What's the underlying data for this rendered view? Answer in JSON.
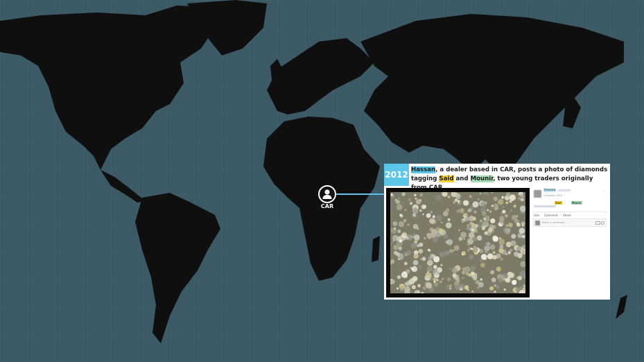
{
  "map": {
    "ocean_color": "#3c5966",
    "land_color": "#0f0f0f",
    "grid": true
  },
  "marker": {
    "label": "CAR",
    "icon": "person-icon",
    "accent": "#5bc6e8"
  },
  "event": {
    "year": "2012",
    "caption": {
      "name1": "Hassan",
      "text1": ", a dealer based in CAR, posts a photo of diamonds tagging ",
      "name2": "Said",
      "text2": " and ",
      "name3": "Mounir",
      "text3": ", two young traders originally from CAR."
    },
    "photo_subject": "diamonds"
  },
  "post": {
    "author": "Hassan",
    "date": "1 January 2012 · ",
    "tag1": "Said",
    "tag2": "Mounir",
    "more_label": "⌄",
    "actions": [
      "Like",
      "Comment",
      "Share"
    ],
    "comment_placeholder": "Write a comment..."
  }
}
